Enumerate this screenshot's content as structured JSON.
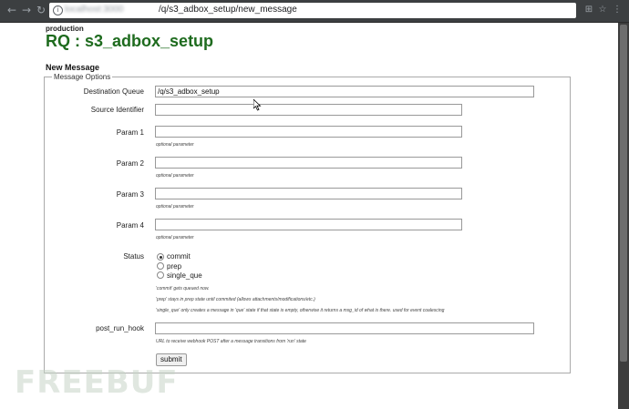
{
  "browser": {
    "url_host": "localhost:3000",
    "url_path": "/q/s3_adbox_setup/new_message"
  },
  "page": {
    "environment": "production",
    "title": "RQ : s3_adbox_setup",
    "section_title": "New Message"
  },
  "form": {
    "legend": "Message Options",
    "destination_queue": {
      "label": "Destination Queue",
      "value": "/q/s3_adbox_setup"
    },
    "source_identifier": {
      "label": "Source Identifier",
      "value": ""
    },
    "params": [
      {
        "label": "Param 1",
        "value": "",
        "help": "optional parameter"
      },
      {
        "label": "Param 2",
        "value": "",
        "help": "optional parameter"
      },
      {
        "label": "Param 3",
        "value": "",
        "help": "optional parameter"
      },
      {
        "label": "Param 4",
        "value": "",
        "help": "optional parameter"
      }
    ],
    "status": {
      "label": "Status",
      "options": [
        "commit",
        "prep",
        "single_que"
      ],
      "selected": "commit",
      "help": [
        "'commit' gets queued now.",
        "'prep' stays in prep state until commited (allows attachments/modifications/etc.)",
        "'single_que' only creates a message in 'que' state if that state is empty, otherwise it returns a msg_id of what is there. used for event coalescing"
      ]
    },
    "post_run_hook": {
      "label": "post_run_hook",
      "value": "",
      "help": "URL to receive webhook POST after a message transitions from 'run' state"
    },
    "submit_label": "submit"
  },
  "watermark": "FREEBUF"
}
